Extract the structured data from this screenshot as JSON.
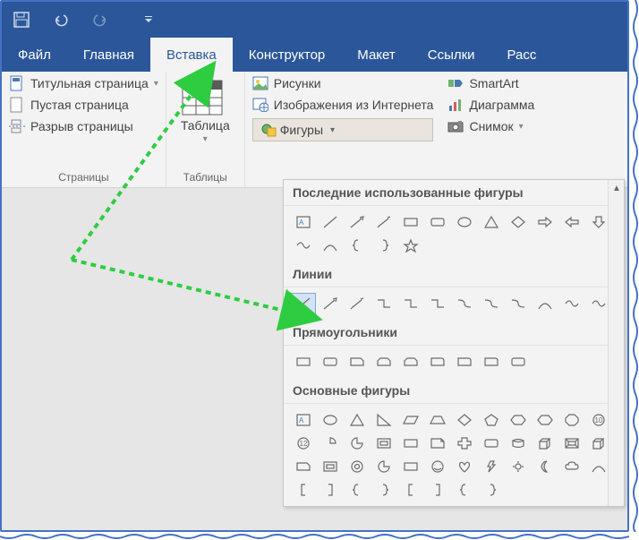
{
  "tabs": {
    "file": "Файл",
    "home": "Главная",
    "insert": "Вставка",
    "design": "Конструктор",
    "layout": "Макет",
    "references": "Ссылки",
    "mail": "Расс"
  },
  "pages_group": {
    "cover": "Титульная страница",
    "blank": "Пустая страница",
    "break": "Разрыв страницы",
    "label": "Страницы"
  },
  "tables_group": {
    "table": "Таблица",
    "label": "Таблицы"
  },
  "illus": {
    "pictures": "Рисунки",
    "online": "Изображения из Интернета",
    "shapes": "Фигуры",
    "smartart": "SmartArt",
    "chart": "Диаграмма",
    "screenshot": "Снимок"
  },
  "dd": {
    "recent": "Последние использованные фигуры",
    "lines": "Линии",
    "rects": "Прямоугольники",
    "basic": "Основные фигуры"
  }
}
